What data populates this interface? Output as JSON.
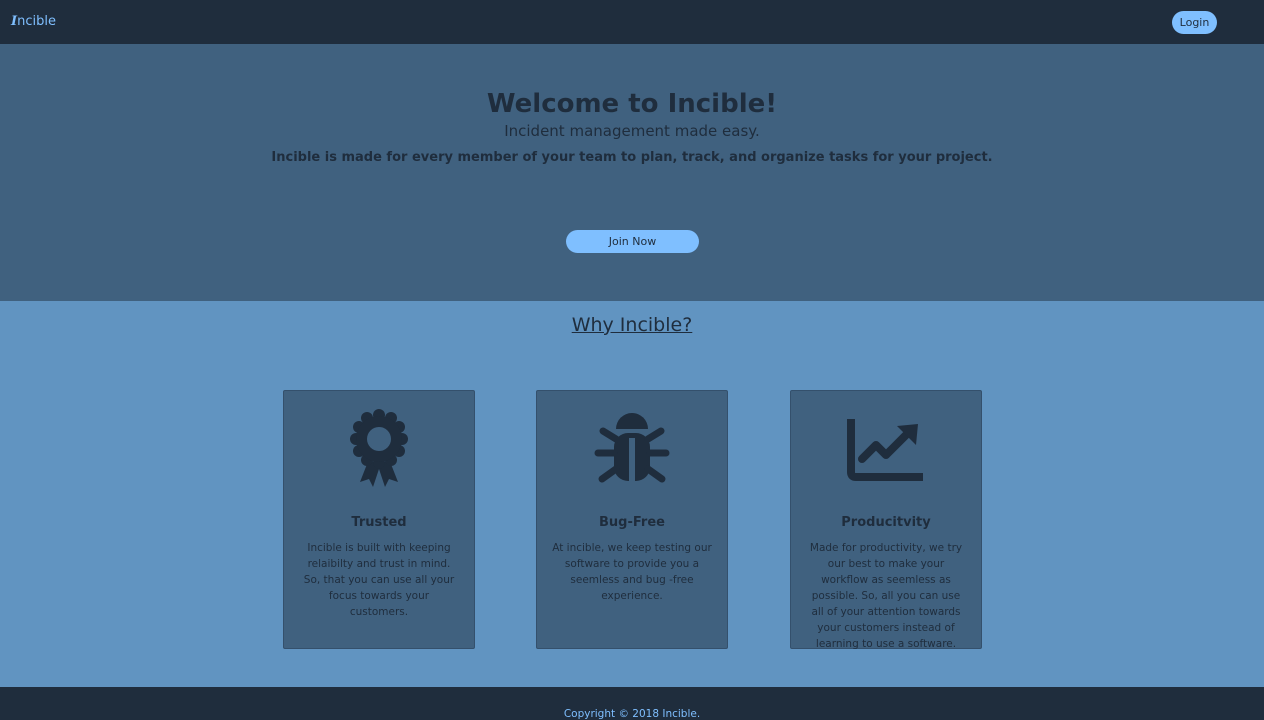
{
  "navbar": {
    "brand_initial": "I",
    "brand_rest": "ncible",
    "login_label": "Login"
  },
  "hero": {
    "title": "Welcome to Incible!",
    "subtitle": "Incident management made easy.",
    "description": "Incible is made for every member of your team to plan, track, and organize tasks for your project.",
    "join_label": "Join Now"
  },
  "why": {
    "title": "Why Incible?",
    "cards": [
      {
        "icon": "award-icon",
        "title": "Trusted",
        "text": "Incible is built with keeping relaibilty and trust in mind. So, that you can use all your focus towards your customers."
      },
      {
        "icon": "bug-icon",
        "title": "Bug-Free",
        "text": "At incible, we keep testing our software to provide you a seemless and bug -free experience."
      },
      {
        "icon": "chart-line-icon",
        "title": "Producitvity",
        "text": "Made for productivity, we try our best to make your workflow as seemless as possible. So, all you can use all of your attention towards your customers instead of learning to use a software."
      }
    ]
  },
  "footer": {
    "copyright": "Copyright © 2018 Incible."
  },
  "colors": {
    "navbar": "#1f2d3d",
    "accent": "#7fbfff",
    "hero": "#40617f",
    "page": "#6194c1",
    "text_dark": "#1f2d3d"
  }
}
